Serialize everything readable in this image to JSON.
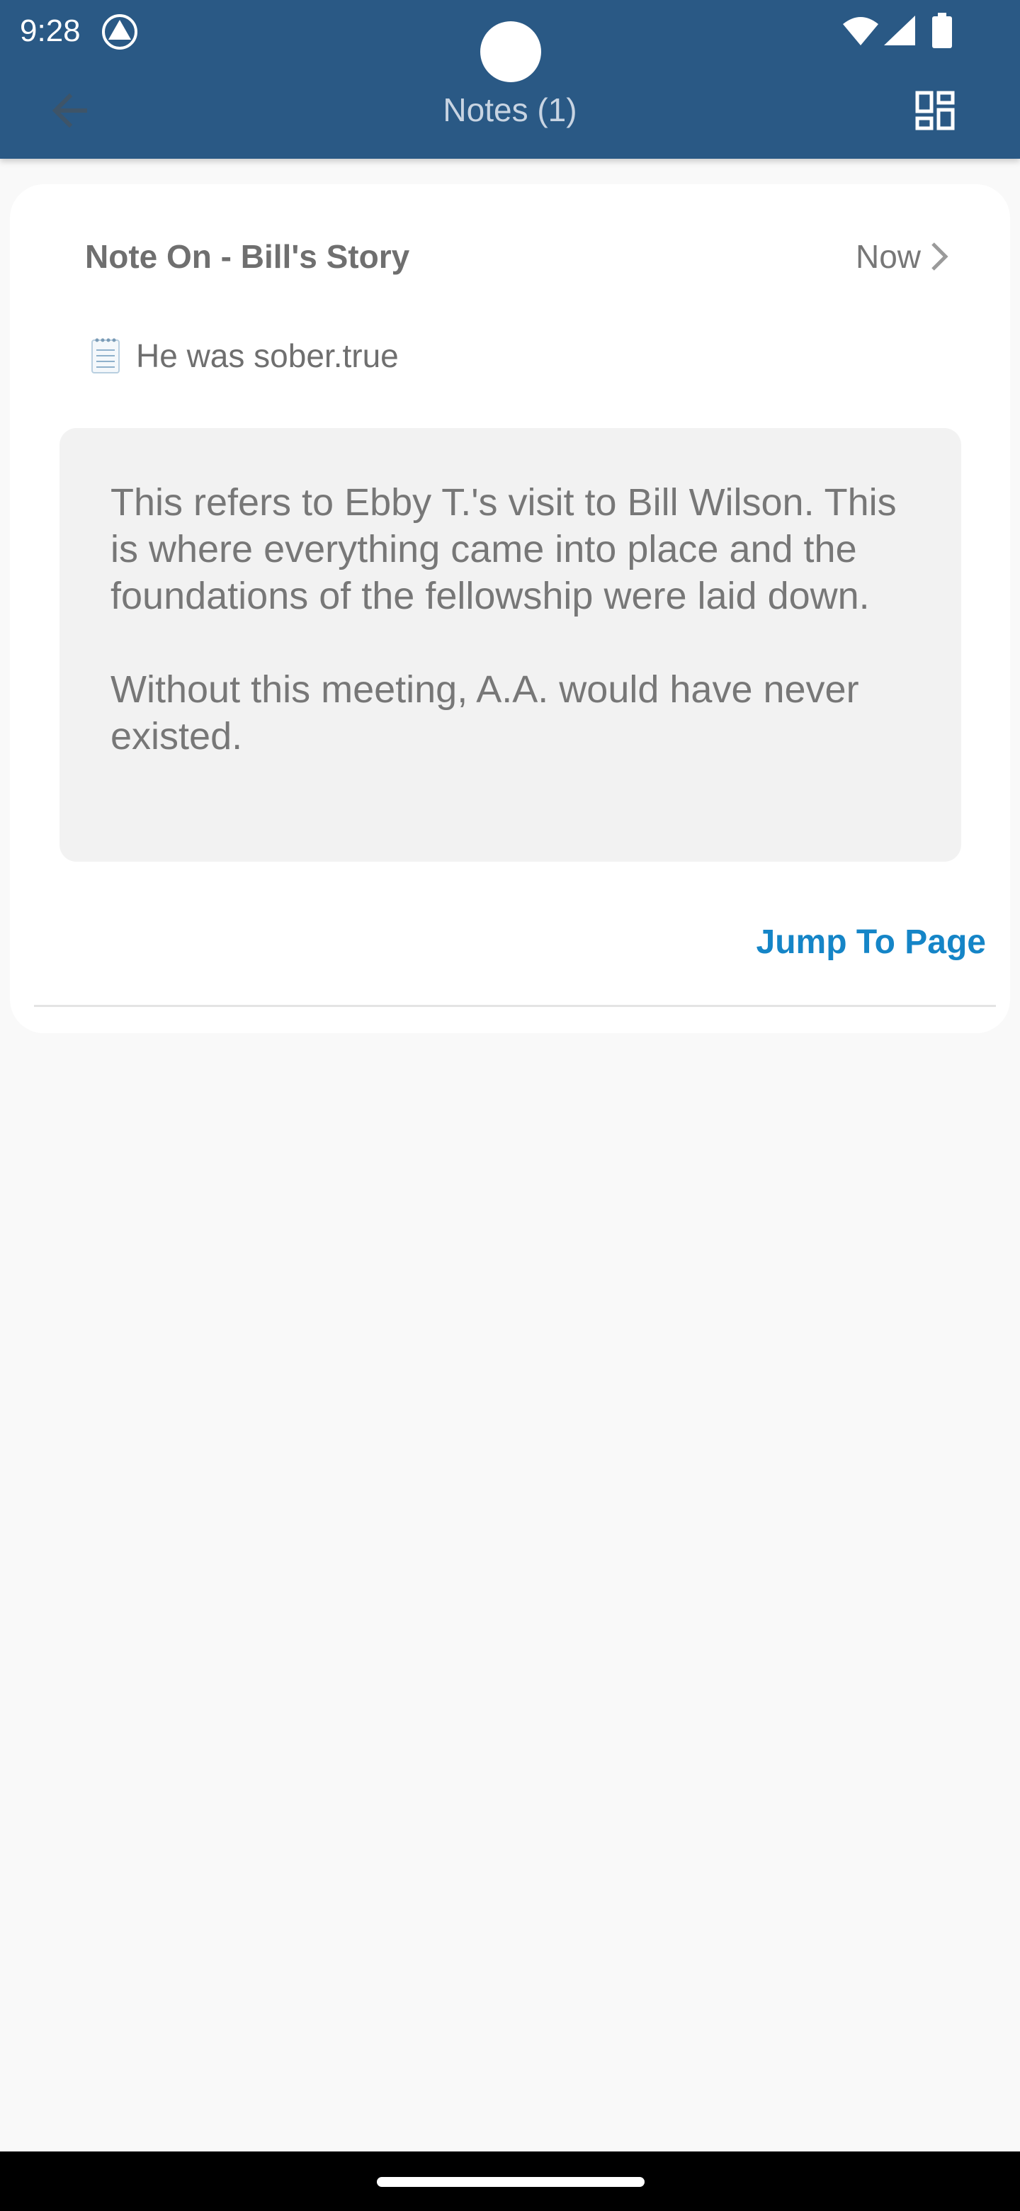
{
  "status_bar": {
    "time": "9:28"
  },
  "toolbar": {
    "title": "Notes (1)"
  },
  "note": {
    "title": "Note On - Bill's Story",
    "time": "Now",
    "highlight": "He was sober.true",
    "paragraphs": [
      "This refers to Ebby T.'s visit to Bill Wilson. This is where everything came into place and the foundations of the fellowship were laid down.",
      "Without this meeting, A.A. would have never existed."
    ],
    "jump_label": "Jump To Page"
  },
  "colors": {
    "header": "#2a5985",
    "accent": "#1585c7",
    "note_box": "#f2f2f2"
  }
}
